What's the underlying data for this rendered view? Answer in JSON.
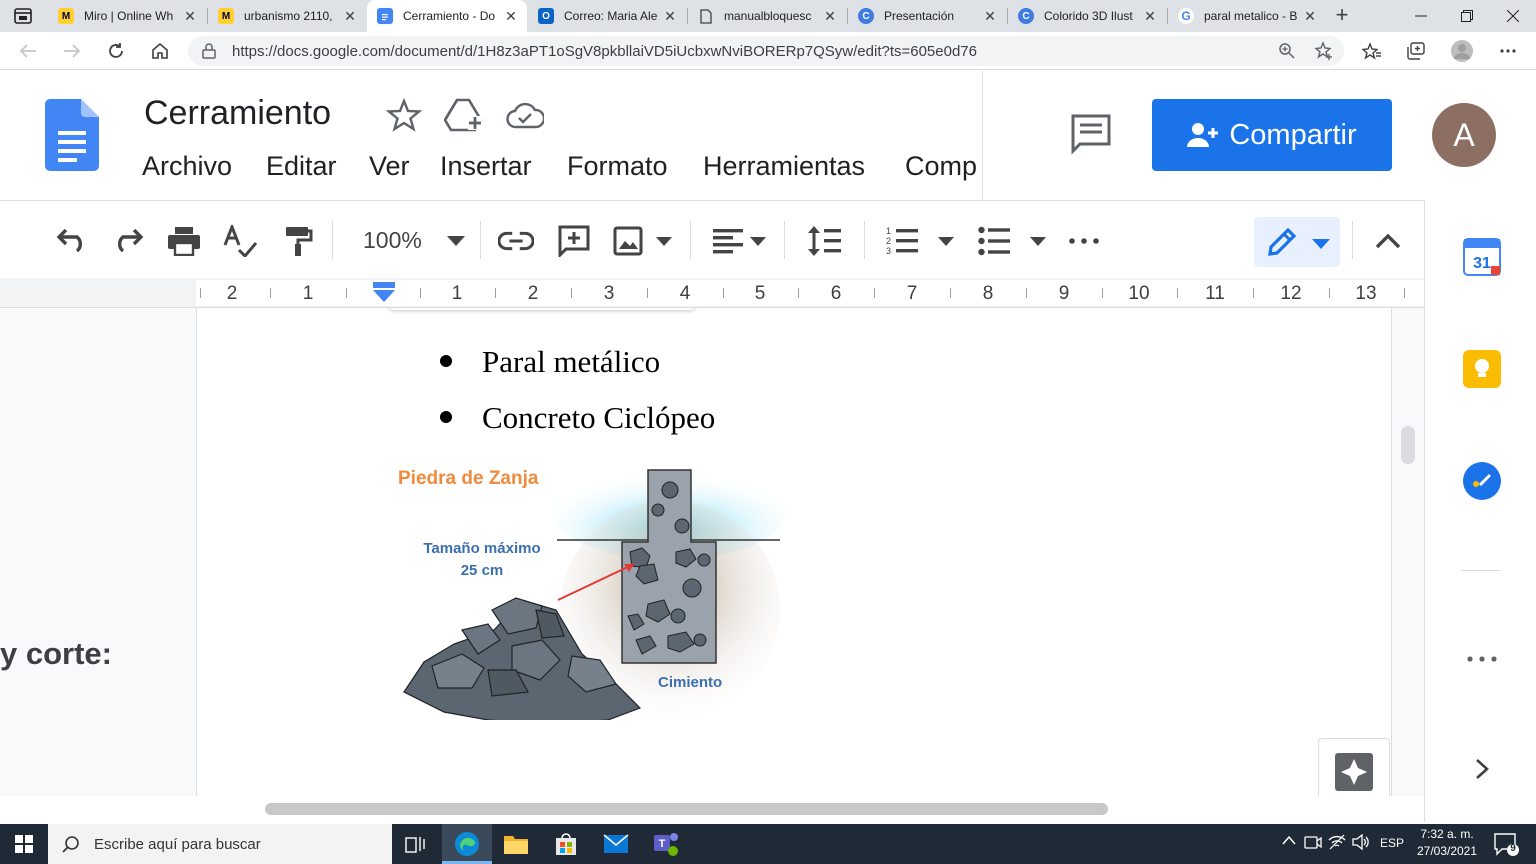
{
  "browser": {
    "tabs": [
      {
        "title": "Miro | Online Wh",
        "favicon": "miro-icon",
        "active": false
      },
      {
        "title": "urbanismo 2110,",
        "favicon": "miro-icon",
        "active": false
      },
      {
        "title": "Cerramiento - Do",
        "favicon": "google-docs-icon",
        "active": true
      },
      {
        "title": "Correo: Maria Ale",
        "favicon": "outlook-icon",
        "active": false
      },
      {
        "title": "manualbloquesc",
        "favicon": "document-icon",
        "active": false
      },
      {
        "title": "Presentación",
        "favicon": "canva-icon",
        "active": false
      },
      {
        "title": "Colorido 3D Ilust",
        "favicon": "canva-icon",
        "active": false
      },
      {
        "title": "paral metalico - B",
        "favicon": "google-icon",
        "active": false
      }
    ],
    "url": "https://docs.google.com/document/d/1H8z3aPT1oSgV8pkbllaiVD5iUcbxwNviBORERp7QSyw/edit?ts=605e0d76"
  },
  "docs": {
    "title": "Cerramiento",
    "menu": [
      "Archivo",
      "Editar",
      "Ver",
      "Insertar",
      "Formato",
      "Herramientas",
      "Comp"
    ],
    "share_label": "Compartir",
    "avatar_letter": "A",
    "zoom": "100%"
  },
  "ruler": {
    "left_numbers": [
      "2",
      "1"
    ],
    "right_numbers": [
      "1",
      "2",
      "3",
      "4",
      "5",
      "6",
      "7",
      "8",
      "9",
      "10",
      "11",
      "12",
      "13"
    ]
  },
  "document": {
    "bullets": [
      "Paral metálico",
      "Concreto Ciclópeo"
    ],
    "side_text": "y corte:",
    "figure": {
      "title": "Piedra de Zanja",
      "size_label_line1": "Tamaño máximo",
      "size_label_line2": "25 cm",
      "foundation_label": "Cimiento"
    }
  },
  "sidepanel": {
    "calendar_day": "31"
  },
  "taskbar": {
    "search_placeholder": "Escribe aquí para buscar",
    "language": "ESP",
    "time": "7:32 a. m.",
    "date": "27/03/2021",
    "notifications": "9"
  },
  "colors": {
    "docs_blue": "#1a73e8",
    "figure_title": "#f08a3c",
    "figure_label": "#3b6fb0",
    "arrow": "#e53935"
  }
}
